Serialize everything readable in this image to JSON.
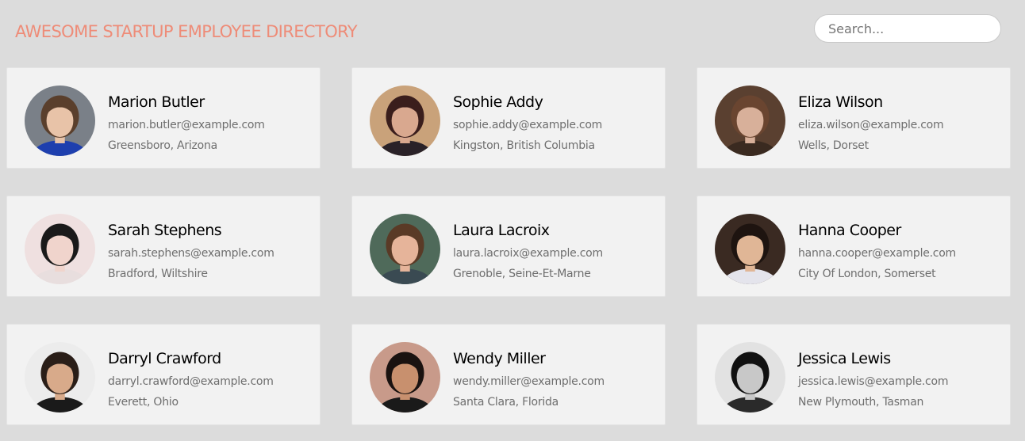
{
  "header": {
    "title": "AWESOME STARTUP EMPLOYEE DIRECTORY",
    "title_color": "#ee8c78",
    "search_placeholder": "Search..."
  },
  "employees": [
    {
      "name": "Marion Butler",
      "email": "marion.butler@example.com",
      "location": "Greensboro, Arizona",
      "avatar": {
        "bg": "#7a8088",
        "skin": "#e8c3a8",
        "hair": "#5a3f2c",
        "shirt": "#1e3fae"
      }
    },
    {
      "name": "Sophie Addy",
      "email": "sophie.addy@example.com",
      "location": "Kingston, British Columbia",
      "avatar": {
        "bg": "#c9a27a",
        "skin": "#d9a88f",
        "hair": "#3a1e1c",
        "shirt": "#2a2228"
      }
    },
    {
      "name": "Eliza Wilson",
      "email": "eliza.wilson@example.com",
      "location": "Wells, Dorset",
      "avatar": {
        "bg": "#5a4030",
        "skin": "#d8b09a",
        "hair": "#6a4530",
        "shirt": "#3a2a20"
      }
    },
    {
      "name": "Sarah Stephens",
      "email": "sarah.stephens@example.com",
      "location": "Bradford, Wiltshire",
      "avatar": {
        "bg": "#efe0e0",
        "skin": "#f0d4cc",
        "hair": "#1a1a1a",
        "shirt": "#e8dede"
      }
    },
    {
      "name": "Laura Lacroix",
      "email": "laura.lacroix@example.com",
      "location": "Grenoble, Seine-Et-Marne",
      "avatar": {
        "bg": "#4f6a5a",
        "skin": "#e6b49a",
        "hair": "#5a3a26",
        "shirt": "#3a4a52"
      }
    },
    {
      "name": "Hanna Cooper",
      "email": "hanna.cooper@example.com",
      "location": "City Of London, Somerset",
      "avatar": {
        "bg": "#3a2a22",
        "skin": "#e0b696",
        "hair": "#1e1410",
        "shirt": "#e4e4ec"
      }
    },
    {
      "name": "Darryl Crawford",
      "email": "darryl.crawford@example.com",
      "location": "Everett, Ohio",
      "avatar": {
        "bg": "#ececec",
        "skin": "#d8aa8a",
        "hair": "#2a1e18",
        "shirt": "#1a1a1a"
      }
    },
    {
      "name": "Wendy Miller",
      "email": "wendy.miller@example.com",
      "location": "Santa Clara, Florida",
      "avatar": {
        "bg": "#c89a8a",
        "skin": "#c8906e",
        "hair": "#1a1210",
        "shirt": "#1a1a1a"
      }
    },
    {
      "name": "Jessica Lewis",
      "email": "jessica.lewis@example.com",
      "location": "New Plymouth, Tasman",
      "avatar": {
        "bg": "#e2e2e2",
        "skin": "#c8c8c8",
        "hair": "#111111",
        "shirt": "#2a2a2a"
      }
    }
  ]
}
